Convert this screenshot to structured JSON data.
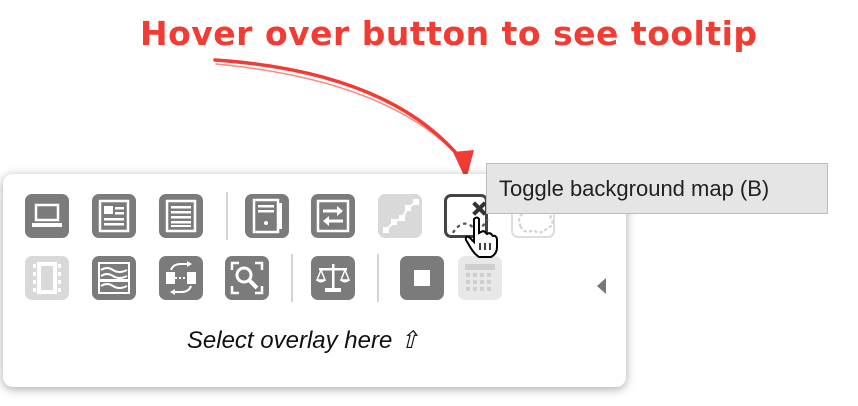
{
  "annotation": {
    "title": "Hover over button to see tooltip",
    "color": "#f23b32"
  },
  "tooltip": {
    "text": "Toggle background map (B)"
  },
  "toolbar": {
    "row1": [
      {
        "name": "laptop-icon",
        "state": "enabled"
      },
      {
        "name": "form-layout-icon",
        "state": "enabled"
      },
      {
        "name": "list-lines-icon",
        "state": "enabled"
      },
      {
        "name": "server-box-icon",
        "state": "enabled"
      },
      {
        "name": "swap-arrows-icon",
        "state": "enabled"
      },
      {
        "name": "node-path-icon",
        "state": "disabled"
      },
      {
        "name": "background-map-icon",
        "state": "active-hover"
      },
      {
        "name": "cloud-shape-icon",
        "state": "disabled"
      }
    ],
    "row2": [
      {
        "name": "film-strip-icon",
        "state": "disabled"
      },
      {
        "name": "wave-lines-icon",
        "state": "enabled"
      },
      {
        "name": "cycle-flow-icon",
        "state": "enabled"
      },
      {
        "name": "zoom-search-icon",
        "state": "enabled"
      },
      {
        "name": "balance-scale-icon",
        "state": "enabled"
      },
      {
        "name": "stop-square-icon",
        "state": "enabled"
      },
      {
        "name": "grid-dots-icon",
        "state": "disabled"
      }
    ],
    "overlay_hint": "Select overlay here ⇧"
  },
  "colors": {
    "button": "#7b7b7b",
    "button_disabled": "#d9d9d9",
    "tooltip_bg": "#e5e5e5"
  }
}
